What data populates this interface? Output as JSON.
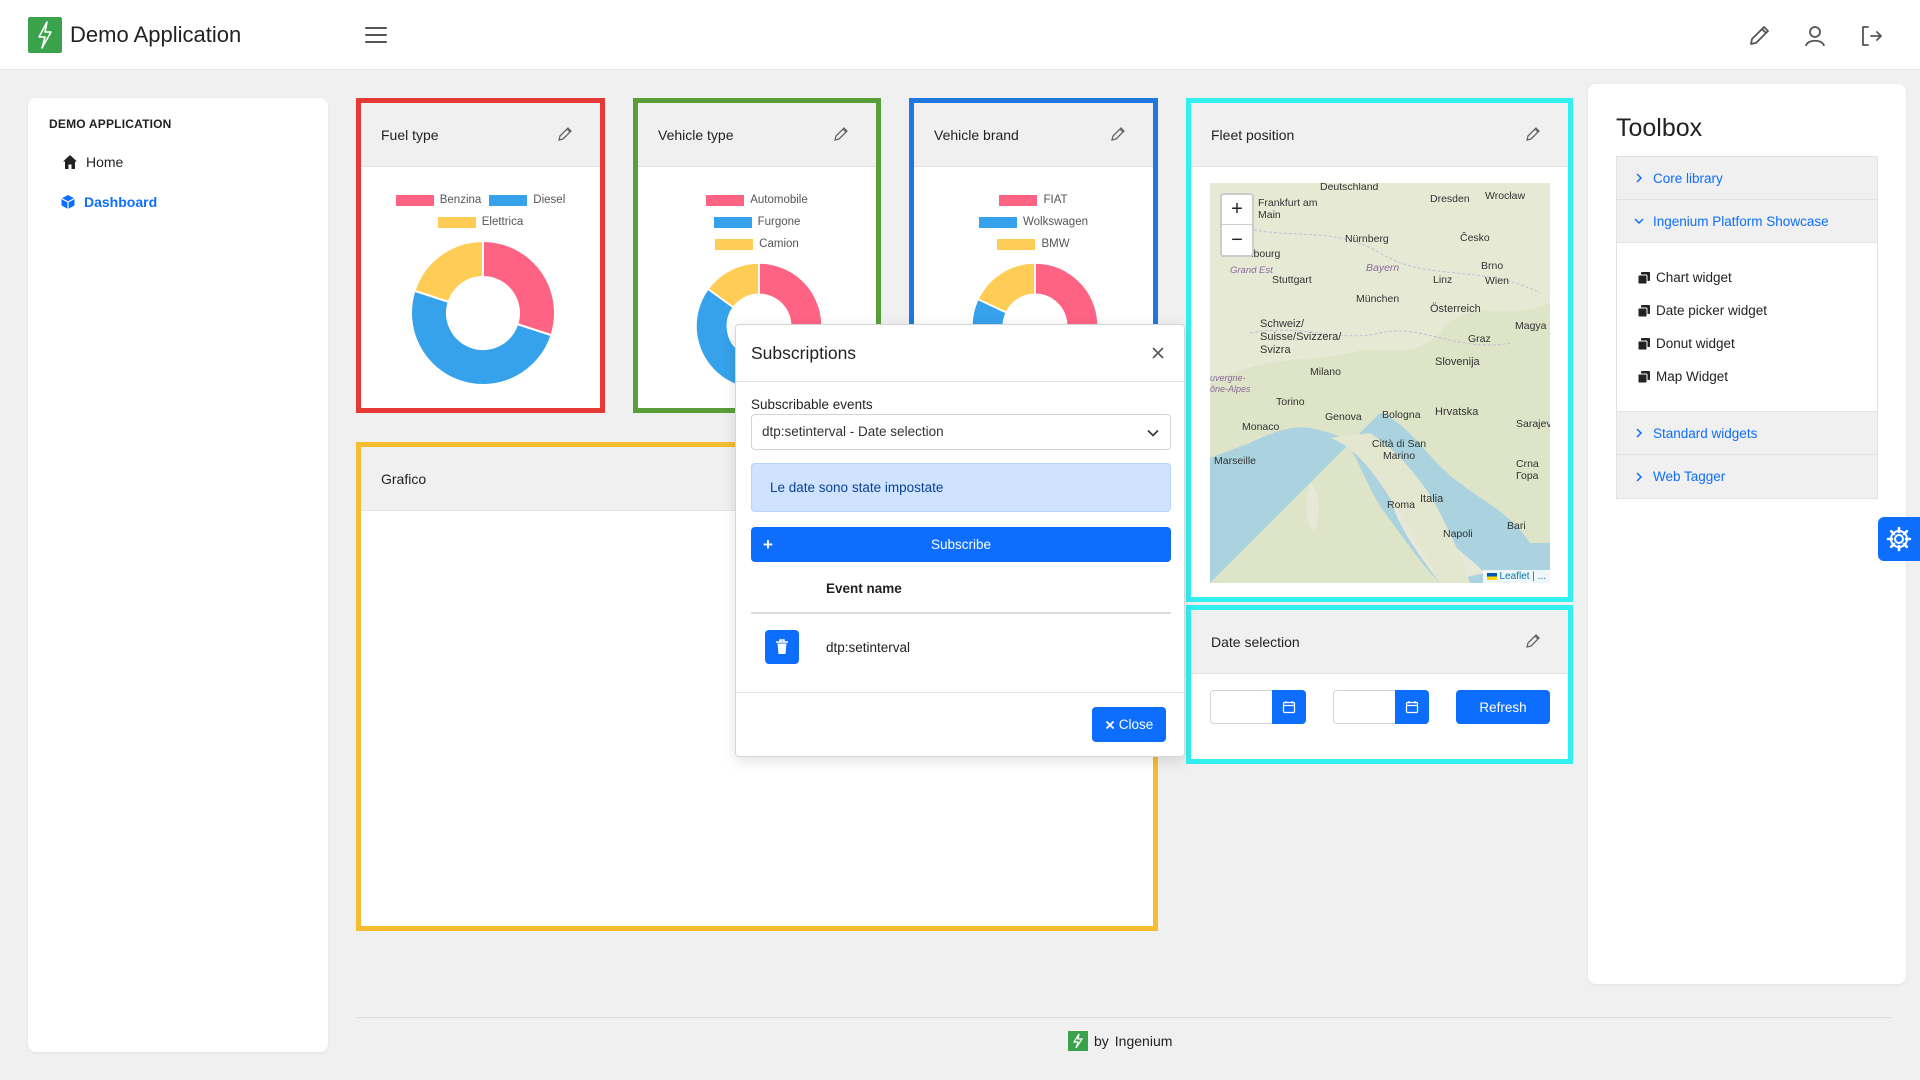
{
  "header": {
    "app_title": "Demo Application",
    "logo_color": "#3aa24a"
  },
  "sidebar": {
    "heading": "DEMO APPLICATION",
    "items": [
      {
        "label": "Home",
        "icon": "home-icon"
      },
      {
        "label": "Dashboard",
        "icon": "cube-icon",
        "active": true
      }
    ]
  },
  "widgets": {
    "fuel": {
      "title": "Fuel type",
      "border_color": "#e53935",
      "chart_data": {
        "type": "pie",
        "donut": true,
        "categories": [
          "Benzina",
          "Diesel",
          "Elettrica"
        ],
        "values": [
          30,
          50,
          20
        ],
        "colors": [
          "#ff6384",
          "#36a2eb",
          "#ffcd56"
        ]
      }
    },
    "vehicle_type": {
      "title": "Vehicle type",
      "border_color": "#5a9e3a",
      "chart_data": {
        "type": "pie",
        "donut": true,
        "categories": [
          "Automobile",
          "Furgone",
          "Camion"
        ],
        "values": [
          35,
          50,
          15
        ],
        "colors": [
          "#ff6384",
          "#36a2eb",
          "#ffcd56"
        ]
      }
    },
    "vehicle_brand": {
      "title": "Vehicle brand",
      "border_color": "#1e78e0",
      "chart_data": {
        "type": "pie",
        "donut": true,
        "categories": [
          "FIAT",
          "Wolkswagen",
          "BMW"
        ],
        "values": [
          42,
          40,
          18
        ],
        "colors": [
          "#ff6384",
          "#36a2eb",
          "#ffcd56"
        ]
      }
    },
    "fleet": {
      "title": "Fleet position",
      "border_color": "#33f0f0",
      "map_labels": [
        "Deutschland",
        "Frankfurt am Main",
        "Dresden",
        "Wrocław",
        "Nürnberg",
        "Česko",
        "Luxembourg",
        "Stuttgart",
        "Bayern",
        "Brno",
        "Wien",
        "Linz",
        "München",
        "Österreich",
        "Schweiz/ Suisse/Svizzera/ Svizra",
        "Graz",
        "Magya",
        "Slovenija",
        "Torino",
        "Milano",
        "Hrvatska",
        "Monaco",
        "Genova",
        "Bologna",
        "Sarajev",
        "Marseille",
        "Città di San Marino",
        "Roma",
        "Italia",
        "Crna Гора",
        "Napoli",
        "Bari",
        "Grand Est",
        "uvergne- ône-Alpes"
      ],
      "attribution": "Leaflet | ...",
      "zoom_in": "+",
      "zoom_out": "−"
    },
    "grafico": {
      "title": "Grafico",
      "border_color": "#f5bd2f"
    },
    "date_selection": {
      "title": "Date selection",
      "border_color": "#33f0f0",
      "refresh_label": "Refresh"
    }
  },
  "modal": {
    "title": "Subscriptions",
    "field_label": "Subscribable events",
    "selected_event": "dtp:setinterval - Date selection",
    "info_text": "Le date sono state impostate",
    "subscribe_label": "Subscribe",
    "table_header": "Event name",
    "rows": [
      "dtp:setinterval"
    ],
    "close_label": "Close"
  },
  "toolbox": {
    "title": "Toolbox",
    "sections": [
      {
        "label": "Core library",
        "expanded": false
      },
      {
        "label": "Ingenium Platform Showcase",
        "expanded": true,
        "items": [
          "Chart widget",
          "Date picker widget",
          "Donut widget",
          "Map Widget"
        ]
      },
      {
        "label": "Standard widgets",
        "expanded": false
      },
      {
        "label": "Web Tagger",
        "expanded": false
      }
    ]
  },
  "footer": {
    "by": "by",
    "brand": "Ingenium"
  },
  "colors": {
    "primary": "#0d6efd",
    "info_bg": "#cfe2ff"
  }
}
